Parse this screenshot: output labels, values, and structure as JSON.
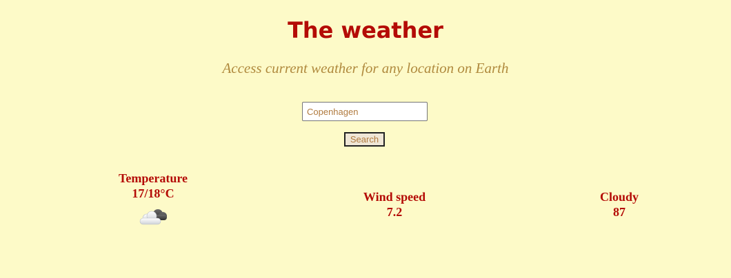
{
  "header": {
    "title": "The weather",
    "subtitle": "Access current weather for any location on Earth"
  },
  "search": {
    "value": "Copenhagen",
    "button_label": "Search"
  },
  "stats": {
    "temperature": {
      "label": "Temperature",
      "value": "17/18°C",
      "icon": "partly-cloudy-icon"
    },
    "wind": {
      "label": "Wind speed",
      "value": "7.2"
    },
    "cloud": {
      "label": "Cloudy",
      "value": "87"
    }
  }
}
